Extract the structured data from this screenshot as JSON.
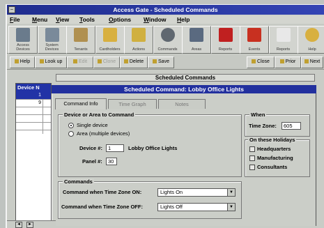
{
  "window": {
    "title": "Access Gate - Scheduled Commands"
  },
  "menu": [
    "File",
    "Menu",
    "View",
    "Tools",
    "Options",
    "Window",
    "Help"
  ],
  "toolbar": [
    {
      "label": "Access Devices",
      "icon": "door-icon",
      "color": "#6a7b8c"
    },
    {
      "label": "System Devices",
      "icon": "computer-icon",
      "color": "#7a8a9a"
    },
    {
      "label": "Tenants",
      "icon": "building-icon",
      "color": "#b09050"
    },
    {
      "label": "Cardholders",
      "icon": "people-icon",
      "color": "#d8b040"
    },
    {
      "label": "Actions",
      "icon": "person-icon",
      "color": "#d0b040"
    },
    {
      "label": "Commands",
      "icon": "clock-icon",
      "color": "#606870"
    },
    {
      "label": "Areas",
      "icon": "areas-icon",
      "color": "#5a6a80"
    },
    {
      "label": "Reports",
      "icon": "alarm-icon",
      "color": "#c02020"
    },
    {
      "label": "Events",
      "icon": "bell-icon",
      "color": "#c83020"
    },
    {
      "label": "Reports",
      "icon": "report-icon",
      "color": "#e8e8e8"
    },
    {
      "label": "Help",
      "icon": "help-icon",
      "color": "#d8b040"
    }
  ],
  "toolbar2": [
    {
      "label": "Help",
      "dim": false
    },
    {
      "label": "Look up",
      "dim": false
    },
    {
      "label": "Edit",
      "dim": true
    },
    {
      "label": "Clone",
      "dim": true
    },
    {
      "label": "Delete",
      "dim": false
    },
    {
      "label": "Save",
      "dim": false
    },
    {
      "label": "Close",
      "dim": false
    },
    {
      "label": "Prior",
      "dim": false
    },
    {
      "label": "Next",
      "dim": false
    }
  ],
  "list_panel": {
    "title": "Scheduled Commands",
    "column_header": "Device N",
    "rows": [
      "1",
      "9",
      "",
      "",
      ""
    ],
    "selected_index": 0
  },
  "dialog": {
    "title": "Scheduled Command: Lobby Office Lights",
    "tabs": [
      "Command Info",
      "Time Graph",
      "Notes"
    ],
    "device_group": {
      "label": "Device or Area to Command",
      "options": [
        "Single device",
        "Area (multiple devices)"
      ],
      "selected_option": 0,
      "device_label": "Device #:",
      "device_value": "1",
      "device_name": "Lobby Office Lights",
      "panel_label": "Panel #:",
      "panel_value": "30"
    },
    "commands_group": {
      "label": "Commands",
      "on_label": "Command when Time Zone ON:",
      "on_value": "Lights On",
      "off_label": "Command when Time Zone OFF:",
      "off_value": "Lights Off"
    },
    "when_group": {
      "label": "When",
      "tz_label": "Time Zone:",
      "tz_value": "605"
    },
    "holidays_group": {
      "label": "On these Holidays",
      "items": [
        "Headquarters",
        "Manufacturing",
        "Consultants"
      ]
    }
  },
  "colors": {
    "titlebar": "#1f2d8f",
    "selection": "#2233a6",
    "face": "#c9ccc6"
  }
}
